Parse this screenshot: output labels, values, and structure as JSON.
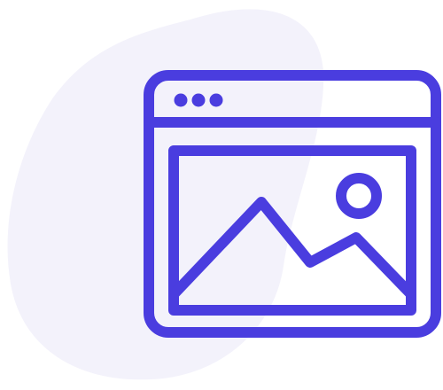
{
  "illustration": {
    "icon_name": "browser-window-image-icon",
    "colors": {
      "stroke": "#4a3ddf",
      "blob": "#f3f2fb",
      "background": "#ffffff"
    },
    "window_dots": 3
  }
}
